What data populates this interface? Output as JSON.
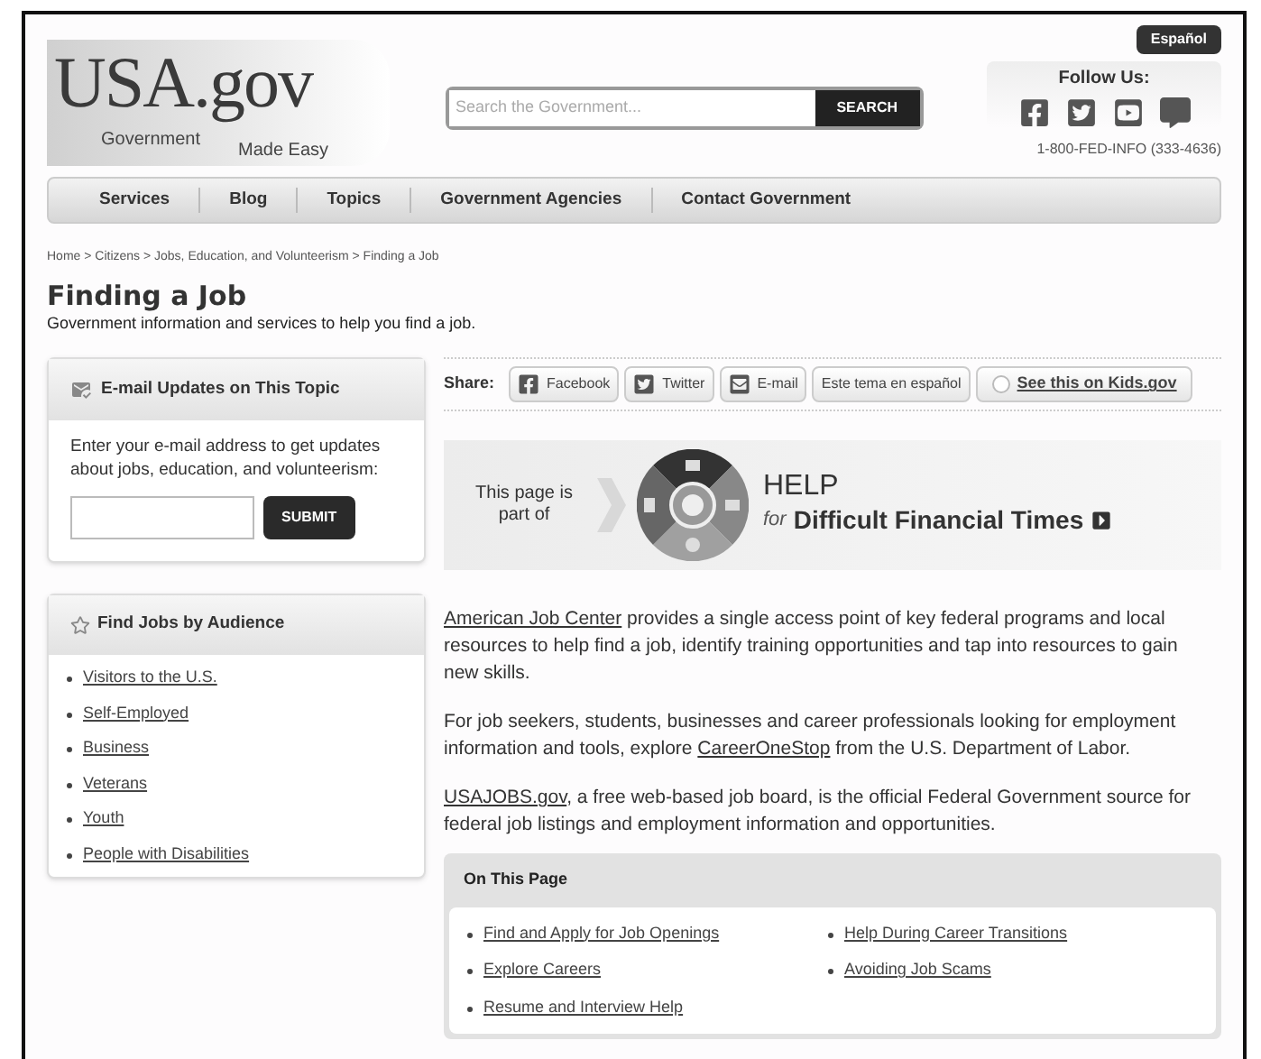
{
  "header": {
    "language_button": "Español",
    "logo": {
      "name": "USA.gov",
      "tagline_left": "Government",
      "tagline_right": "Made Easy"
    },
    "search": {
      "placeholder": "Search the Government...",
      "button": "SEARCH"
    },
    "follow": {
      "title": "Follow Us:",
      "icons": [
        {
          "kind": "facebook"
        },
        {
          "kind": "twitter"
        },
        {
          "kind": "youtube"
        },
        {
          "kind": "blog"
        }
      ],
      "phone": "1-800-FED-INFO (333-4636)"
    }
  },
  "nav": [
    "Services",
    "Blog",
    "Topics",
    "Government Agencies",
    "Contact Government"
  ],
  "breadcrumb": "Home > Citizens > Jobs, Education, and Volunteerism > Finding a Job",
  "page": {
    "title": "Finding a Job",
    "subtitle": "Government information and services to help you find a job."
  },
  "email_box": {
    "title": "E-mail Updates on This Topic",
    "text": "Enter your e-mail address to get updates about jobs, education, and volunteerism:",
    "button": "SUBMIT"
  },
  "audience_box": {
    "title": "Find Jobs by Audience",
    "links": [
      "Visitors to the U.S.",
      "Self-Employed",
      "Business",
      "Veterans",
      "Youth",
      "People with Disabilities"
    ]
  },
  "share": {
    "label": "Share:",
    "buttons": [
      {
        "kind": "facebook",
        "label": "Facebook"
      },
      {
        "kind": "twitter",
        "label": "Twitter"
      },
      {
        "kind": "email",
        "label": "E-mail"
      },
      {
        "kind": "plain",
        "label": "Este tema en español"
      },
      {
        "kind": "kids",
        "label": "See this on Kids.gov"
      }
    ]
  },
  "banner": {
    "intro": "This page is part of",
    "help": "HELP",
    "for": "for",
    "title": "Difficult Financial Times"
  },
  "paragraphs": [
    [
      {
        "kind": "link",
        "text": "American Job Center"
      },
      {
        "kind": "text",
        "text": " provides a single access point of key federal programs and local resources to help find a job, identify training opportunities and tap into resources to gain new skills."
      }
    ],
    [
      {
        "kind": "text",
        "text": "For job seekers, students, businesses and career professionals looking for employment information and tools, explore "
      },
      {
        "kind": "link",
        "text": "CareerOneStop"
      },
      {
        "kind": "text",
        "text": " from the U.S. Department of Labor."
      }
    ],
    [
      {
        "kind": "link",
        "text": "USAJOBS.gov"
      },
      {
        "kind": "text",
        "text": ", a free web-based job board, is the official Federal Government source for federal job listings and employment information and opportunities."
      }
    ]
  ],
  "on_this_page": {
    "title": "On This Page",
    "columns": [
      [
        "Find and Apply for Job Openings",
        "Explore Careers",
        "Resume and Interview Help"
      ],
      [
        "Help During Career Transitions",
        "Avoiding Job Scams"
      ]
    ]
  }
}
